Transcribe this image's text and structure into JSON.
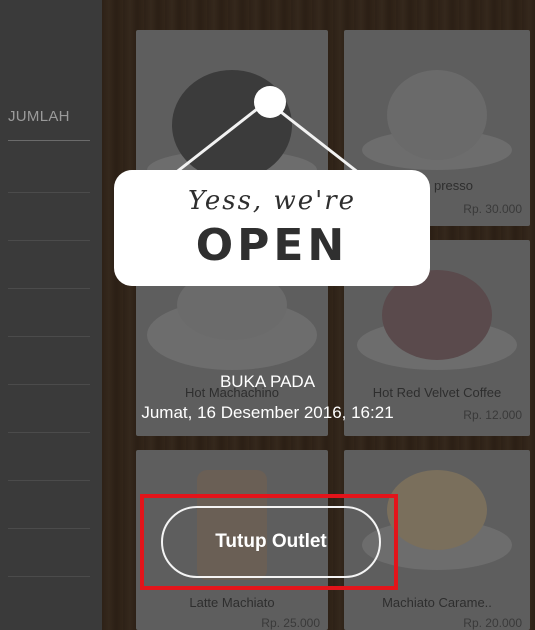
{
  "order_panel": {
    "column_header": "JUMLAH"
  },
  "menu": {
    "items": [
      {
        "name": "",
        "price": ""
      },
      {
        "name": "presso",
        "price": "Rp. 30.000"
      },
      {
        "name": "Hot Machachino",
        "price": ""
      },
      {
        "name": "Hot Red Velvet Coffee",
        "price": "Rp. 12.000"
      },
      {
        "name": "Latte Machiato",
        "price": "Rp. 25.000"
      },
      {
        "name": "Machiato Carame..",
        "price": "Rp. 20.000"
      }
    ]
  },
  "sign": {
    "script_text": "Yess, we're",
    "main_text": "OPEN"
  },
  "status": {
    "title": "BUKA PADA",
    "datetime": "Jumat, 16 Desember 2016, 16:21"
  },
  "actions": {
    "close_outlet_label": "Tutup Outlet"
  },
  "colors": {
    "highlight": "#e3141a",
    "overlay_text": "#ffffff"
  }
}
